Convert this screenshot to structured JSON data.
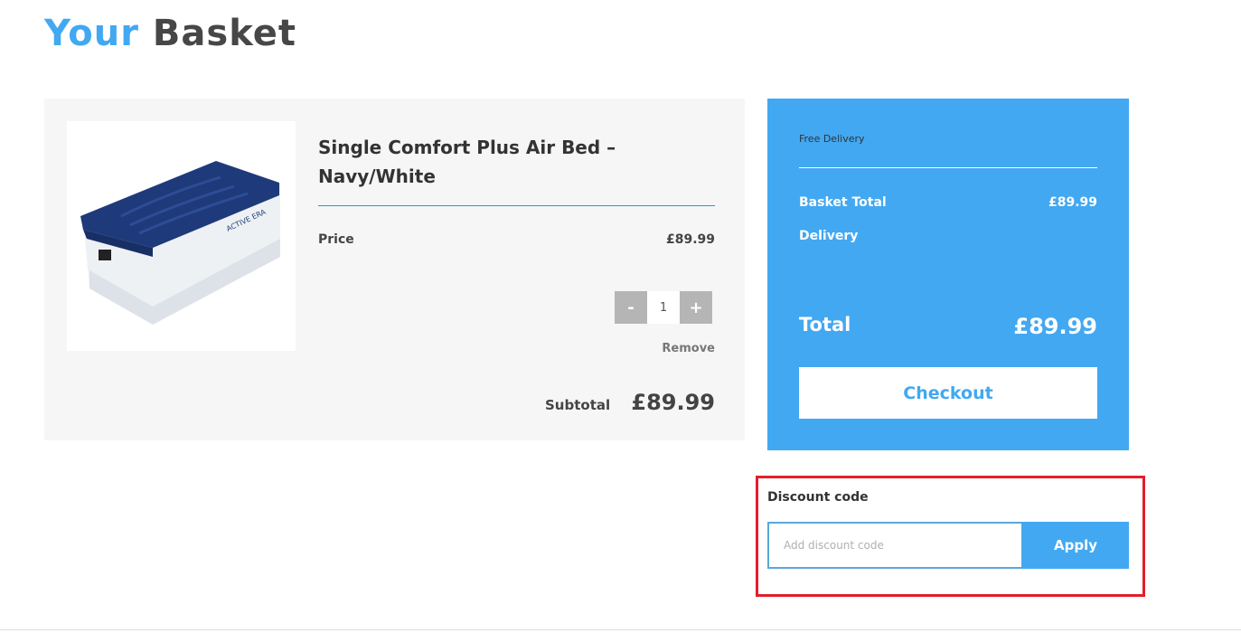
{
  "header": {
    "title_part1": "Your",
    "title_part2": "Basket"
  },
  "item": {
    "name": "Single Comfort Plus Air Bed – Navy/White",
    "image_logo_text": "ACTIVE ERA",
    "price_label": "Price",
    "price": "£89.99",
    "quantity": "1",
    "decrement": "-",
    "increment": "+",
    "remove_label": "Remove",
    "subtotal_label": "Subtotal",
    "subtotal": "£89.99"
  },
  "summary": {
    "delivery_note": "Free Delivery",
    "basket_total_label": "Basket Total",
    "basket_total": "£89.99",
    "delivery_label": "Delivery",
    "delivery_value": "",
    "total_label": "Total",
    "total": "£89.99",
    "checkout_label": "Checkout"
  },
  "discount": {
    "label": "Discount code",
    "placeholder": "Add discount code",
    "value": "",
    "apply_label": "Apply"
  },
  "colors": {
    "accent": "#42a8f2",
    "highlight": "#e0202a"
  }
}
